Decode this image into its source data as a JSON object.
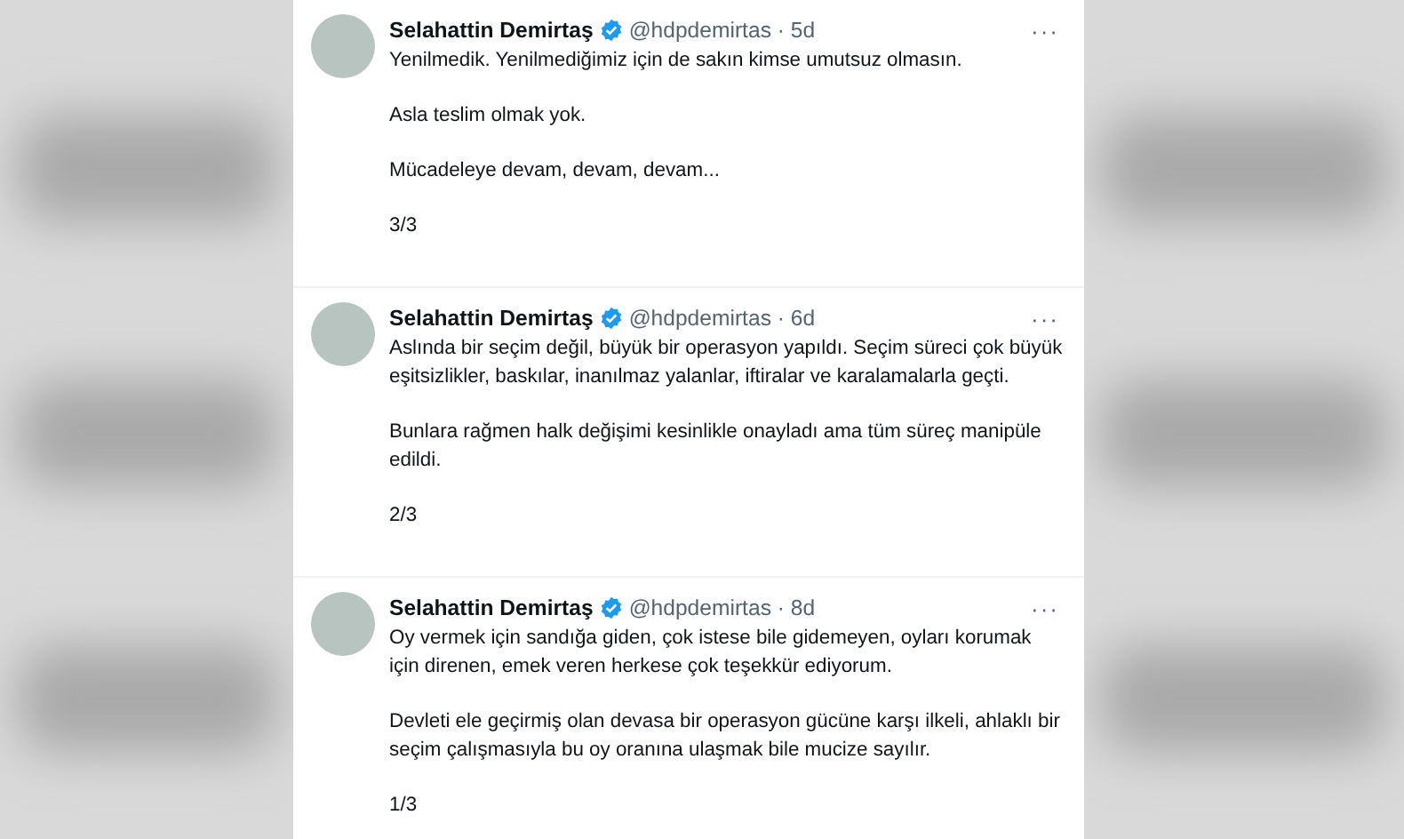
{
  "tweets": [
    {
      "author": "Selahattin Demirtaş",
      "verified": true,
      "handle": "@hdpdemirtas",
      "separator": "·",
      "time": "5d",
      "more": "···",
      "paragraphs": [
        "Yenilmedik. Yenilmediğimiz için de sakın kimse umutsuz olmasın.",
        "Asla teslim olmak yok.",
        "Mücadeleye devam, devam, devam...",
        "3/3"
      ]
    },
    {
      "author": "Selahattin Demirtaş",
      "verified": true,
      "handle": "@hdpdemirtas",
      "separator": "·",
      "time": "6d",
      "more": "···",
      "paragraphs": [
        "Aslında bir seçim değil, büyük bir operasyon yapıldı. Seçim süreci çok büyük eşitsizlikler, baskılar, inanılmaz yalanlar, iftiralar ve karalamalarla geçti.",
        "Bunlara rağmen halk değişimi kesinlikle onayladı ama tüm süreç manipüle edildi.",
        "2/3"
      ]
    },
    {
      "author": "Selahattin Demirtaş",
      "verified": true,
      "handle": "@hdpdemirtas",
      "separator": "·",
      "time": "8d",
      "more": "···",
      "paragraphs": [
        "Oy vermek için sandığa giden, çok istese bile gidemeyen, oyları korumak için direnen, emek veren herkese çok teşekkür ediyorum.",
        "Devleti ele geçirmiş olan devasa bir operasyon gücüne karşı ilkeli, ahlaklı bir seçim çalışmasıyla bu oy oranına ulaşmak bile mucize sayılır.",
        "1/3"
      ]
    }
  ]
}
